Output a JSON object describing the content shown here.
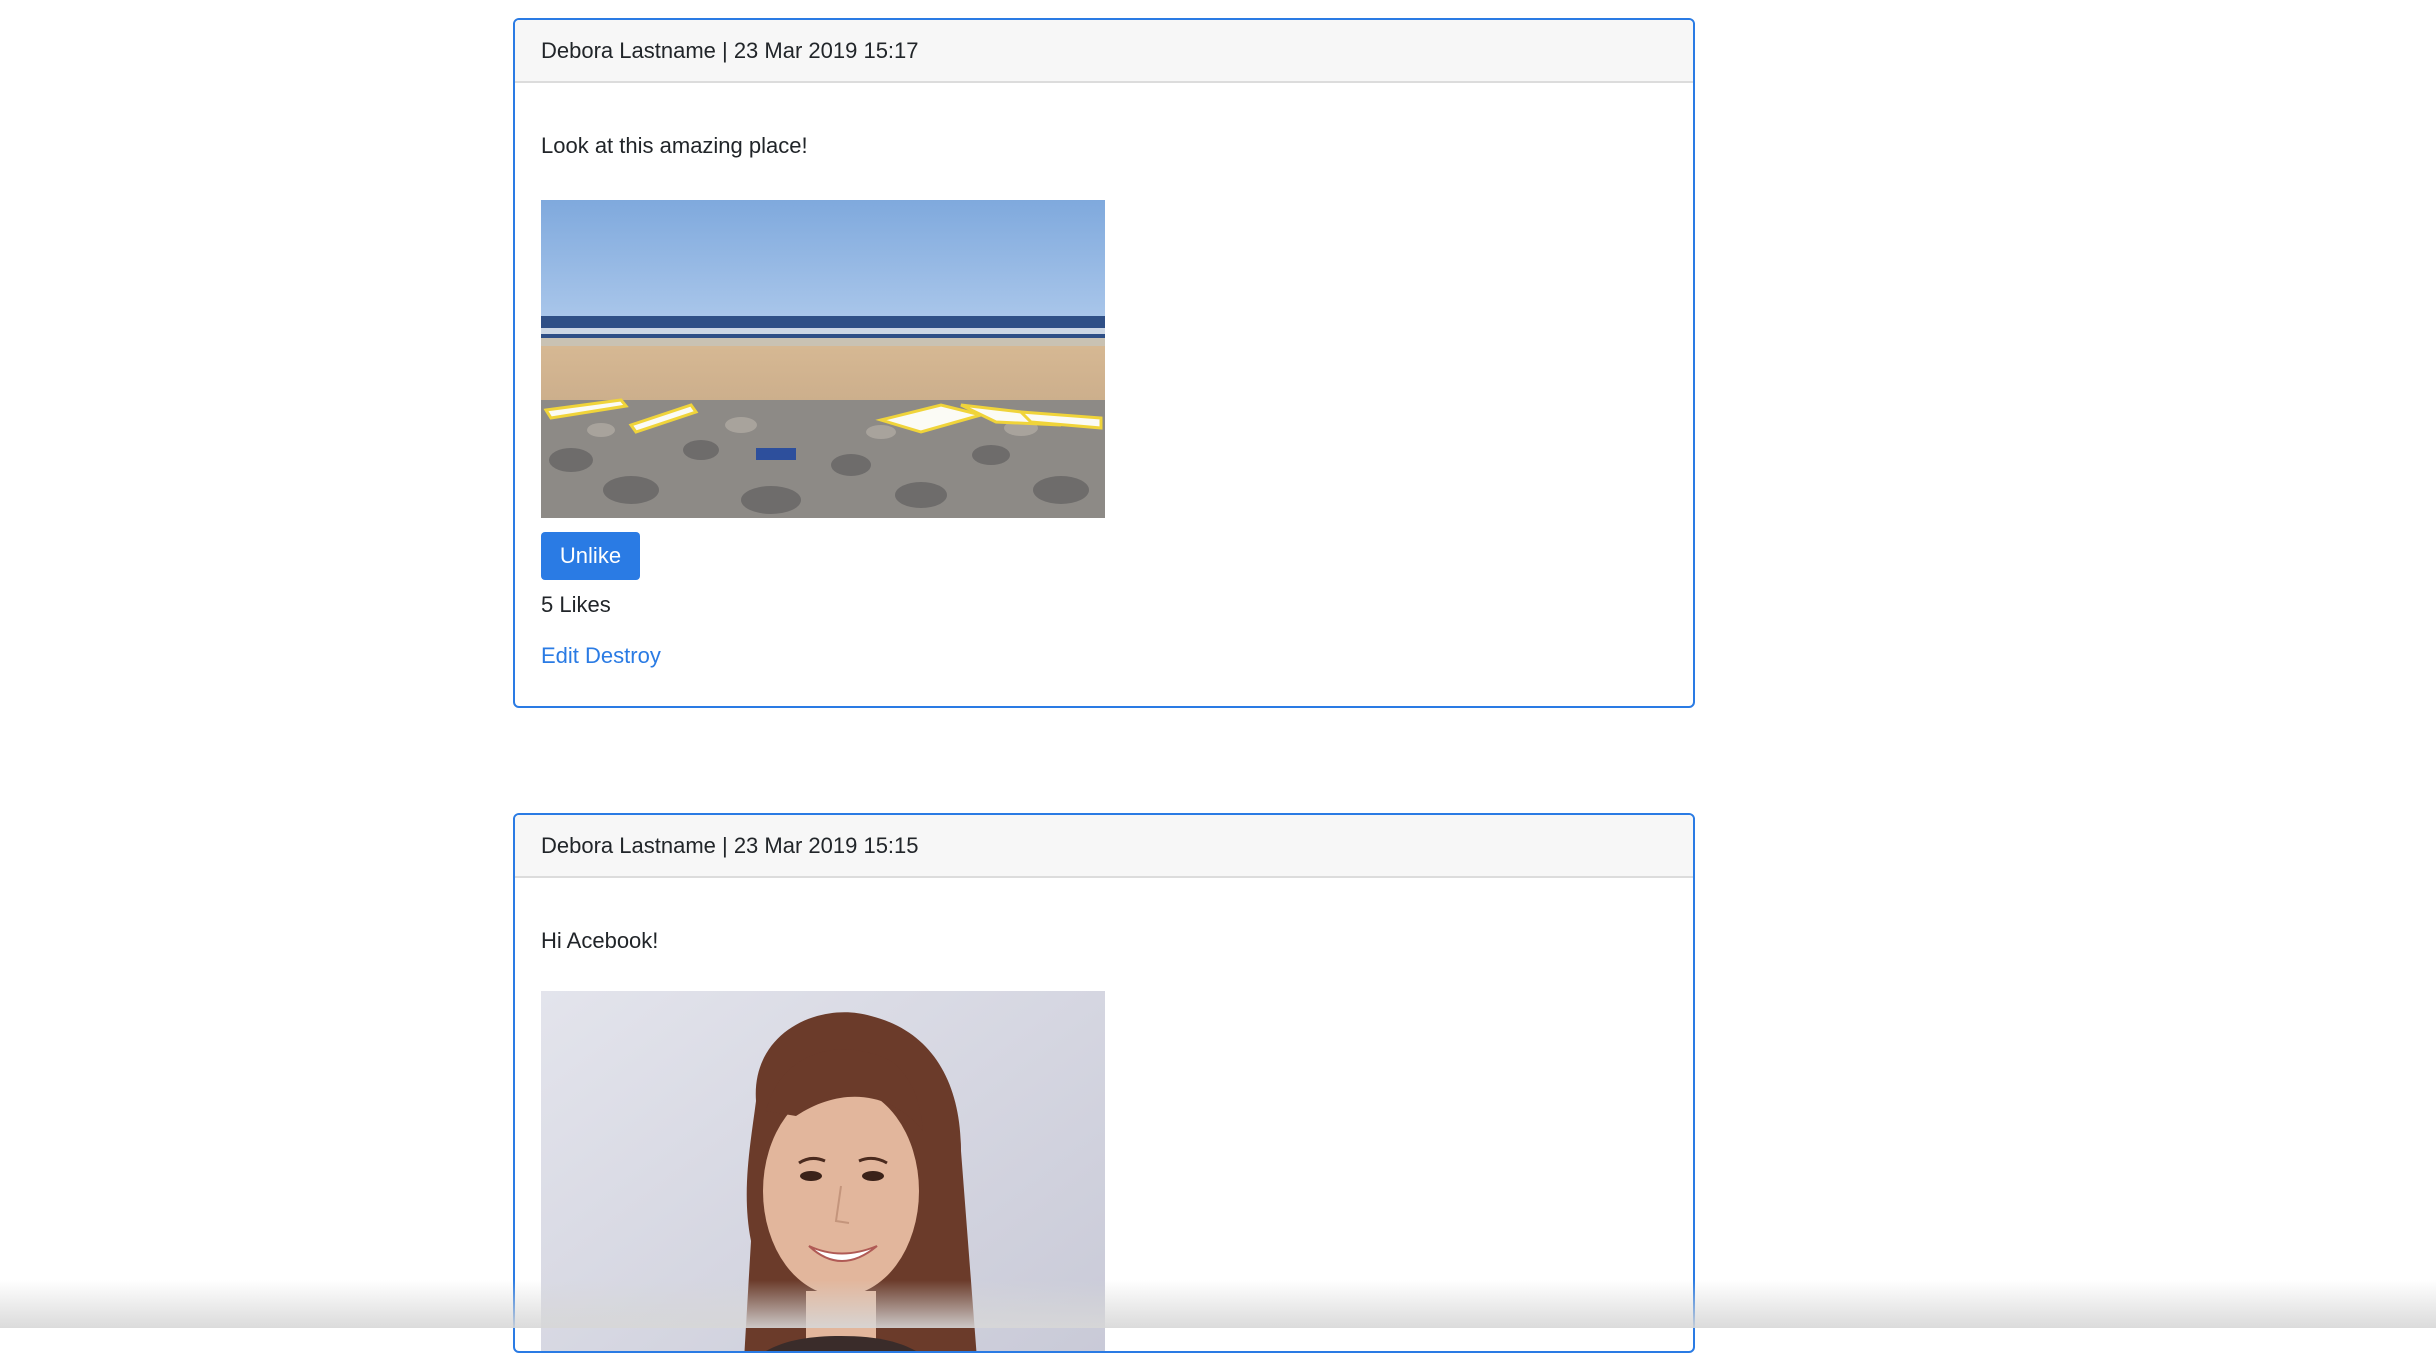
{
  "posts": [
    {
      "header": "Debora Lastname | 23 Mar 2019 15:17",
      "text": "Look at this amazing place!",
      "image_subject": "beach with surfboards on rocky sand",
      "like_button_label": "Unlike",
      "likes_label": "5 Likes",
      "edit_label": "Edit",
      "destroy_label": "Destroy"
    },
    {
      "header": "Debora Lastname | 23 Mar 2019 15:15",
      "text": "Hi Acebook!",
      "image_subject": "portrait of smiling woman with long brown hair"
    }
  ],
  "colors": {
    "accent": "#2a7be4",
    "header_bg": "#f7f7f7"
  }
}
